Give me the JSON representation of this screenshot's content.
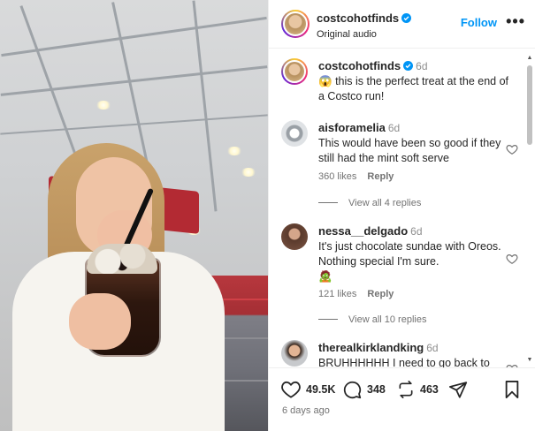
{
  "post": {
    "author": "costcohotfinds",
    "audio": "Original audio",
    "follow_label": "Follow",
    "more_label": "•••",
    "caption": {
      "author": "costcohotfinds",
      "time": "6d",
      "emoji": "😱",
      "text": "this is the perfect treat at the end of a Costco run!"
    }
  },
  "comments": [
    {
      "user": "aisforamelia",
      "time": "6d",
      "text": "This would have been so good if they still had the mint soft serve",
      "likes": "360 likes",
      "reply_label": "Reply",
      "view_replies": "View all 4 replies"
    },
    {
      "user": "nessa__delgado",
      "time": "6d",
      "text": "It's just chocolate sundae with Oreos. Nothing special I'm sure.",
      "emoji": "🧟",
      "likes": "121 likes",
      "reply_label": "Reply",
      "view_replies": "View all 10 replies"
    },
    {
      "user": "therealkirklandking",
      "time": "6d",
      "text": "BRUHHHHHH I need to go back to"
    }
  ],
  "actions": {
    "likes_count": "49.5K",
    "comments_count": "348",
    "reposts_count": "463"
  },
  "posted_ago": "6 days ago",
  "colors": {
    "accent": "#0095f6",
    "verified": "#0095f6",
    "text": "#262626",
    "muted": "#737373"
  }
}
